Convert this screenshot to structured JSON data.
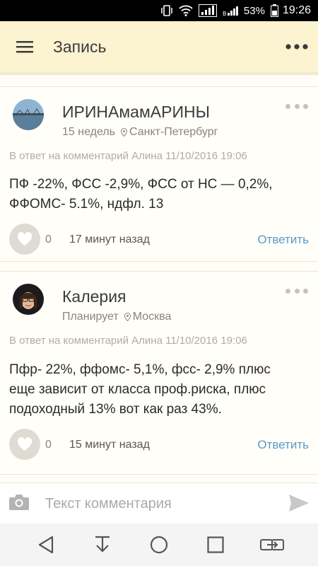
{
  "status_bar": {
    "icons": [
      "vibrate-icon",
      "wifi-icon",
      "signal-sim1-icon",
      "signal-sim2-icon",
      "battery-icon"
    ],
    "battery_percent": "53%",
    "time": "19:26"
  },
  "app_bar": {
    "title": "Запись",
    "menu_icon": "hamburger-icon",
    "more_icon": "more-dots-icon"
  },
  "comments": [
    {
      "author": "ИРИНАмамАРИНЫ",
      "status": "15 недель",
      "location": "Санкт-Петербург",
      "reply_to": "В ответ на комментарий Алина  11/10/2016 19:06",
      "text": "ПФ -22%, ФСС -2,9%, ФСС от НС — 0,2%, ФФОМС- 5.1%, ндфл. 13",
      "likes": "0",
      "time": "17 минут назад",
      "reply_label": "Ответить"
    },
    {
      "author": "Калерия",
      "status": "Планирует",
      "location": "Москва",
      "reply_to": "В ответ на комментарий Алина  11/10/2016 19:06",
      "text": "Пфр- 22%, ффомс- 5,1%, фсс- 2,9% плюс еще зависит от класса проф.риска, плюс подоходный 13% вот как раз 43%.",
      "likes": "0",
      "time": "15 минут назад",
      "reply_label": "Ответить"
    }
  ],
  "comment_input": {
    "placeholder": "Текст комментария",
    "value": ""
  },
  "nav_bar": {
    "icons": [
      "back-icon",
      "notification-pull-icon",
      "home-icon",
      "recents-icon",
      "switch-sim-icon"
    ]
  },
  "colors": {
    "app_bar_bg": "#fcf3d0",
    "reply_link": "#5a9ac7",
    "like_bg": "#dedbd2"
  }
}
